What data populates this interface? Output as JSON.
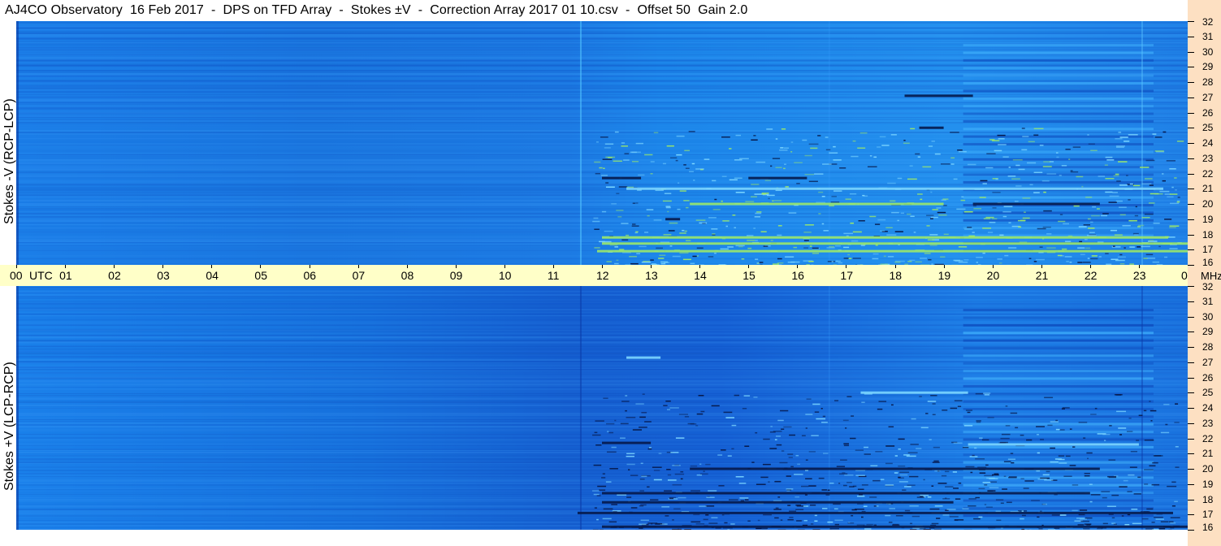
{
  "header": {
    "title": "AJ4CO Observatory  16 Feb 2017  -  DPS on TFD Array  -  Stokes ±V  -  Correction Array 2017 01 10.csv  -  Offset 50  Gain 2.0"
  },
  "chart_data": {
    "type": "heatmap",
    "title": "AJ4CO Observatory  16 Feb 2017  -  DPS on TFD Array  -  Stokes ±V  -  Correction Array 2017 01 10.csv  -  Offset 50  Gain 2.0",
    "x_axis": {
      "unit_label": "UTC",
      "tick_labels": [
        "00",
        "01",
        "02",
        "03",
        "04",
        "05",
        "06",
        "07",
        "08",
        "09",
        "10",
        "11",
        "12",
        "13",
        "14",
        "15",
        "16",
        "17",
        "18",
        "19",
        "20",
        "21",
        "22",
        "23",
        "00"
      ],
      "range_hours": [
        0,
        24
      ]
    },
    "y_axis": {
      "unit_label": "MHz",
      "tick_labels": [
        "32",
        "31",
        "30",
        "29",
        "28",
        "27",
        "26",
        "25",
        "24",
        "23",
        "22",
        "21",
        "20",
        "19",
        "18",
        "17",
        "16"
      ],
      "range_mhz": [
        16,
        32
      ]
    },
    "panels": [
      {
        "ylabel": "Stokes -V (RCP-LCP)",
        "features": [
          {
            "freq_mhz": 17.4,
            "start_utc": 12.0,
            "end_utc": 24.0,
            "tone": "bright"
          },
          {
            "freq_mhz": 16.9,
            "start_utc": 11.9,
            "end_utc": 24.0,
            "tone": "bright"
          },
          {
            "freq_mhz": 17.8,
            "start_utc": 12.0,
            "end_utc": 23.6,
            "tone": "bright"
          },
          {
            "freq_mhz": 20.0,
            "start_utc": 13.8,
            "end_utc": 19.0,
            "tone": "bright"
          },
          {
            "freq_mhz": 20.0,
            "start_utc": 19.6,
            "end_utc": 22.2,
            "tone": "dark"
          },
          {
            "freq_mhz": 21.7,
            "start_utc": 12.0,
            "end_utc": 12.8,
            "tone": "dark"
          },
          {
            "freq_mhz": 21.7,
            "start_utc": 15.0,
            "end_utc": 16.2,
            "tone": "dark"
          },
          {
            "freq_mhz": 21.0,
            "start_utc": 12.5,
            "end_utc": 23.5,
            "tone": "light"
          },
          {
            "freq_mhz": 25.0,
            "start_utc": 18.5,
            "end_utc": 19.0,
            "tone": "dark"
          },
          {
            "freq_mhz": 27.1,
            "start_utc": 18.2,
            "end_utc": 19.6,
            "tone": "dark"
          },
          {
            "freq_mhz": 19.0,
            "start_utc": 13.3,
            "end_utc": 13.6,
            "tone": "dark"
          }
        ]
      },
      {
        "ylabel": "Stokes +V (LCP-RCP)",
        "features": [
          {
            "freq_mhz": 17.1,
            "start_utc": 11.5,
            "end_utc": 23.7,
            "tone": "dark"
          },
          {
            "freq_mhz": 17.8,
            "start_utc": 12.0,
            "end_utc": 19.2,
            "tone": "dark"
          },
          {
            "freq_mhz": 16.2,
            "start_utc": 12.0,
            "end_utc": 24.0,
            "tone": "dark"
          },
          {
            "freq_mhz": 20.0,
            "start_utc": 13.8,
            "end_utc": 22.2,
            "tone": "dark"
          },
          {
            "freq_mhz": 21.7,
            "start_utc": 12.0,
            "end_utc": 13.0,
            "tone": "dark"
          },
          {
            "freq_mhz": 21.6,
            "start_utc": 19.5,
            "end_utc": 23.0,
            "tone": "light"
          },
          {
            "freq_mhz": 25.0,
            "start_utc": 17.3,
            "end_utc": 19.5,
            "tone": "light"
          },
          {
            "freq_mhz": 27.3,
            "start_utc": 12.5,
            "end_utc": 13.2,
            "tone": "light"
          },
          {
            "freq_mhz": 18.4,
            "start_utc": 12.0,
            "end_utc": 22.0,
            "tone": "dark"
          }
        ]
      }
    ],
    "colors": {
      "background_blue": "#1e7fe6",
      "deep_blue": "#1150c8",
      "bright": "#9be86a",
      "light": "#7cd6ff",
      "dark": "#06184a",
      "time_axis_bg": "#ffffc8",
      "freq_axis_bg": "#fde0c2"
    }
  }
}
